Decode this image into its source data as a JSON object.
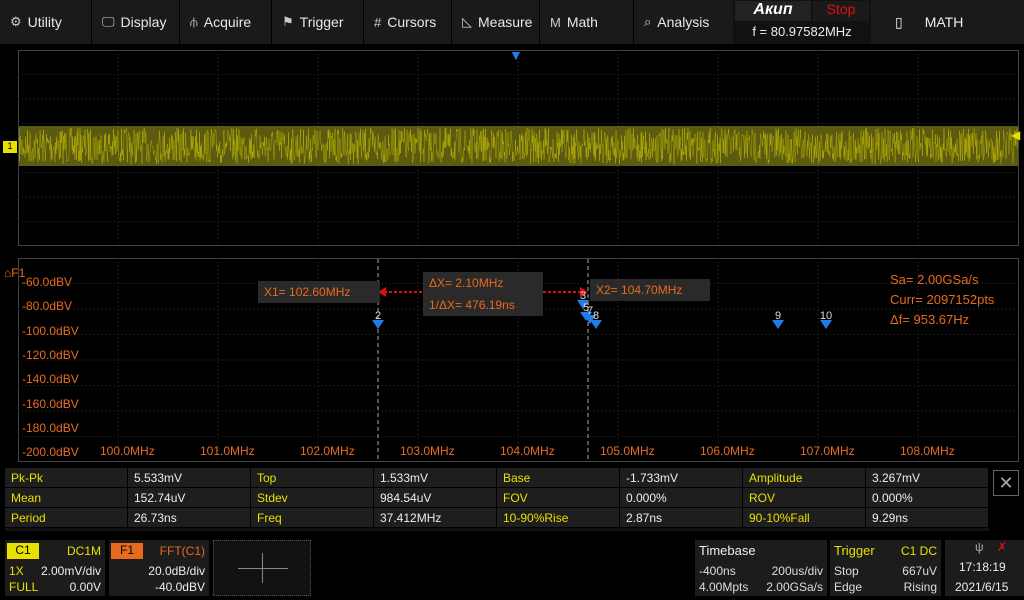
{
  "menu": [
    {
      "icon": "gear-icon",
      "glyph": "⚙",
      "label": "Utility"
    },
    {
      "icon": "monitor-icon",
      "glyph": "🖵",
      "label": "Display"
    },
    {
      "icon": "acquire-icon",
      "glyph": "⫛",
      "label": "Acquire"
    },
    {
      "icon": "flag-icon",
      "glyph": "⚑",
      "label": "Trigger"
    },
    {
      "icon": "cursors-icon",
      "glyph": "#",
      "label": "Cursors"
    },
    {
      "icon": "ruler-icon",
      "glyph": "◺",
      "label": "Measure"
    },
    {
      "icon": "math-icon",
      "glyph": "M",
      "label": "Math"
    },
    {
      "icon": "analysis-icon",
      "glyph": "⌕",
      "label": "Analysis"
    }
  ],
  "brand": {
    "logo": "Акип",
    "state": "Stop",
    "freq": "f = 80.97582MHz"
  },
  "math_button": {
    "icon": "battery-icon",
    "label": "MATH"
  },
  "colors": {
    "ch1": "#e8e000",
    "fft": "#e86a1e",
    "marker": "#1e7ee8",
    "cursor": "#e01010"
  },
  "ch1_marker": "1",
  "fft": {
    "label": "F1",
    "ylabels": [
      "-60.0dBV",
      "-80.0dBV",
      "-100.0dBV",
      "-120.0dBV",
      "-140.0dBV",
      "-160.0dBV",
      "-180.0dBV",
      "-200.0dBV"
    ],
    "xlabels": [
      "100.0MHz",
      "101.0MHz",
      "102.0MHz",
      "103.0MHz",
      "104.0MHz",
      "105.0MHz",
      "106.0MHz",
      "107.0MHz",
      "108.0MHz"
    ],
    "x1": "X1= 102.60MHz",
    "x2": "X2= 104.70MHz",
    "dx": "ΔX= 2.10MHz",
    "inv_dx": "1/ΔX= 476.19ns",
    "sa": "Sa=  2.00GSa/s",
    "curr": "Curr= 2097152pts",
    "df": "Δf=  953.67Hz",
    "markers": [
      {
        "label": "2",
        "mhz": 102.6
      },
      {
        "label": "3",
        "mhz": 104.65
      },
      {
        "label": "5",
        "mhz": 104.68
      },
      {
        "label": "7",
        "mhz": 104.72
      },
      {
        "label": "8",
        "mhz": 104.78
      },
      {
        "label": "9",
        "mhz": 106.6
      },
      {
        "label": "10",
        "mhz": 107.08
      }
    ],
    "peaks": [
      {
        "mhz": 100.55,
        "db": -120
      },
      {
        "mhz": 101.1,
        "db": -123
      },
      {
        "mhz": 101.6,
        "db": -108
      },
      {
        "mhz": 102.1,
        "db": -112
      },
      {
        "mhz": 102.6,
        "db": -100
      },
      {
        "mhz": 103.1,
        "db": -118
      },
      {
        "mhz": 104.28,
        "db": -108
      },
      {
        "mhz": 104.74,
        "db": -93
      },
      {
        "mhz": 105.1,
        "db": -122
      },
      {
        "mhz": 105.6,
        "db": -108
      },
      {
        "mhz": 106.1,
        "db": -112
      },
      {
        "mhz": 106.6,
        "db": -102
      },
      {
        "mhz": 107.1,
        "db": -104
      },
      {
        "mhz": 107.6,
        "db": -120
      }
    ],
    "x_range_mhz": [
      99.0,
      109.0
    ],
    "y_range_dbv": [
      -200,
      -60
    ],
    "cursor_x1_mhz": 102.6,
    "cursor_x2_mhz": 104.7,
    "noise_floor_dbv": -140
  },
  "measurements": [
    [
      "Pk-Pk",
      "5.533mV",
      "Top",
      "1.533mV",
      "Base",
      "-1.733mV",
      "Amplitude",
      "3.267mV"
    ],
    [
      "Mean",
      "152.74uV",
      "Stdev",
      "984.54uV",
      "FOV",
      "0.000%",
      "ROV",
      "0.000%"
    ],
    [
      "Period",
      "26.73ns",
      "Freq",
      "37.412MHz",
      "10-90%Rise",
      "2.87ns",
      "90-10%Fall",
      "9.29ns"
    ]
  ],
  "close_glyph": "✕",
  "c1": {
    "name": "C1",
    "coupling": "DC1M",
    "probe": "1X",
    "scale": "2.00mV/div",
    "bw": "FULL",
    "offset": "0.00V"
  },
  "f1": {
    "name": "F1",
    "src": "FFT(C1)",
    "scale": "20.0dB/div",
    "offset": "-40.0dBV"
  },
  "timebase": {
    "title": "Timebase",
    "delay": "-400ns",
    "scale": "200us/div",
    "mpts": "4.00Mpts",
    "sa": "2.00GSa/s"
  },
  "trigger": {
    "title": "Trigger",
    "src": "C1 DC",
    "state": "Stop",
    "level": "667uV",
    "type": "Edge",
    "slope": "Rising"
  },
  "clock": {
    "time": "17:18:19",
    "date": "2021/6/15"
  }
}
